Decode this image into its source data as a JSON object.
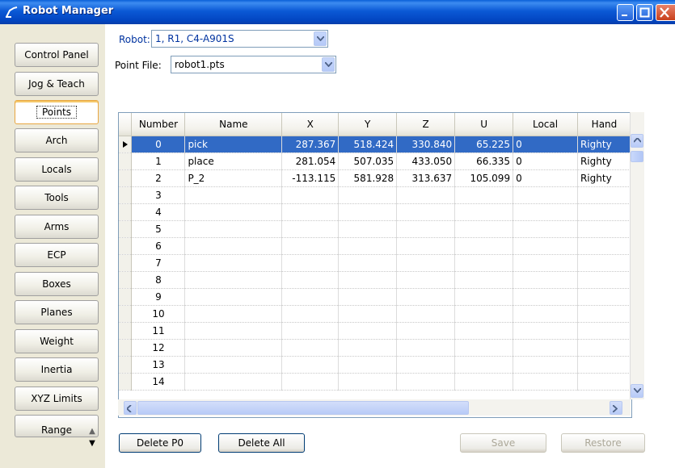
{
  "window": {
    "title": "Robot Manager"
  },
  "nav": {
    "items": [
      {
        "label": "Control Panel"
      },
      {
        "label": "Jog & Teach"
      },
      {
        "label": "Points"
      },
      {
        "label": "Arch"
      },
      {
        "label": "Locals"
      },
      {
        "label": "Tools"
      },
      {
        "label": "Arms"
      },
      {
        "label": "ECP"
      },
      {
        "label": "Boxes"
      },
      {
        "label": "Planes"
      },
      {
        "label": "Weight"
      },
      {
        "label": "Inertia"
      },
      {
        "label": "XYZ Limits"
      },
      {
        "label": "Range"
      }
    ],
    "active": "Points"
  },
  "robot": {
    "label": "Robot:",
    "value": "1, R1, C4-A901S"
  },
  "point_file": {
    "label": "Point File:",
    "value": "robot1.pts"
  },
  "grid": {
    "columns": [
      "Number",
      "Name",
      "X",
      "Y",
      "Z",
      "U",
      "Local",
      "Hand"
    ],
    "rows": [
      {
        "num": "0",
        "name": "pick",
        "x": "287.367",
        "y": "518.424",
        "z": "330.840",
        "u": "65.225",
        "local": "0",
        "hand": "Righty"
      },
      {
        "num": "1",
        "name": "place",
        "x": "281.054",
        "y": "507.035",
        "z": "433.050",
        "u": "66.335",
        "local": "0",
        "hand": "Righty"
      },
      {
        "num": "2",
        "name": "P_2",
        "x": "-113.115",
        "y": "581.928",
        "z": "313.637",
        "u": "105.099",
        "local": "0",
        "hand": "Righty"
      },
      {
        "num": "3",
        "name": "",
        "x": "",
        "y": "",
        "z": "",
        "u": "",
        "local": "",
        "hand": ""
      },
      {
        "num": "4",
        "name": "",
        "x": "",
        "y": "",
        "z": "",
        "u": "",
        "local": "",
        "hand": ""
      },
      {
        "num": "5",
        "name": "",
        "x": "",
        "y": "",
        "z": "",
        "u": "",
        "local": "",
        "hand": ""
      },
      {
        "num": "6",
        "name": "",
        "x": "",
        "y": "",
        "z": "",
        "u": "",
        "local": "",
        "hand": ""
      },
      {
        "num": "7",
        "name": "",
        "x": "",
        "y": "",
        "z": "",
        "u": "",
        "local": "",
        "hand": ""
      },
      {
        "num": "8",
        "name": "",
        "x": "",
        "y": "",
        "z": "",
        "u": "",
        "local": "",
        "hand": ""
      },
      {
        "num": "9",
        "name": "",
        "x": "",
        "y": "",
        "z": "",
        "u": "",
        "local": "",
        "hand": ""
      },
      {
        "num": "10",
        "name": "",
        "x": "",
        "y": "",
        "z": "",
        "u": "",
        "local": "",
        "hand": ""
      },
      {
        "num": "11",
        "name": "",
        "x": "",
        "y": "",
        "z": "",
        "u": "",
        "local": "",
        "hand": ""
      },
      {
        "num": "12",
        "name": "",
        "x": "",
        "y": "",
        "z": "",
        "u": "",
        "local": "",
        "hand": ""
      },
      {
        "num": "13",
        "name": "",
        "x": "",
        "y": "",
        "z": "",
        "u": "",
        "local": "",
        "hand": ""
      },
      {
        "num": "14",
        "name": "",
        "x": "",
        "y": "",
        "z": "",
        "u": "",
        "local": "",
        "hand": ""
      }
    ],
    "selected_row": 0
  },
  "buttons": {
    "delete_p0": "Delete P0",
    "delete_all": "Delete All",
    "save": "Save",
    "restore": "Restore"
  },
  "colors": {
    "title_bar": "#0b59d6",
    "selection": "#316ac5"
  }
}
